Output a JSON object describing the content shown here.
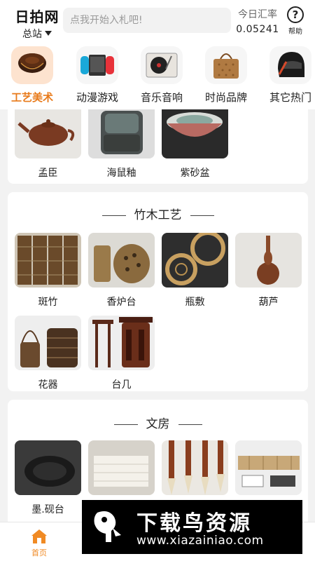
{
  "header": {
    "brand_title": "日拍网",
    "brand_sub": "总站",
    "search_placeholder": "点我开始入札吧!",
    "rate_label": "今日汇率",
    "rate_value": "0.05241",
    "help_label": "帮助",
    "help_symbol": "?"
  },
  "categories": [
    {
      "label": "工艺美术",
      "icon": "lacquer-box-icon",
      "active": true
    },
    {
      "label": "动漫游戏",
      "icon": "game-controller-icon",
      "active": false
    },
    {
      "label": "音乐音响",
      "icon": "turntable-icon",
      "active": false
    },
    {
      "label": "时尚品牌",
      "icon": "handbag-icon",
      "active": false
    },
    {
      "label": "其它热门",
      "icon": "helmet-icon",
      "active": false
    }
  ],
  "section_top": {
    "items": [
      {
        "label": "孟臣",
        "icon": "teapot-icon"
      },
      {
        "label": "海鼠釉",
        "icon": "glazed-pot-icon"
      },
      {
        "label": "紫砂盆",
        "icon": "bowl-icon"
      }
    ]
  },
  "section_bamboo": {
    "title": "竹木工艺",
    "items": [
      {
        "label": "斑竹",
        "icon": "screen-icon"
      },
      {
        "label": "香炉台",
        "icon": "incense-burner-icon"
      },
      {
        "label": "瓶敷",
        "icon": "woven-mat-icon"
      },
      {
        "label": "葫芦",
        "icon": "gourd-vase-icon"
      },
      {
        "label": "花器",
        "icon": "flower-basket-icon"
      },
      {
        "label": "台几",
        "icon": "stand-table-icon"
      }
    ]
  },
  "section_study": {
    "title": "文房",
    "items": [
      {
        "label": "墨.砚台",
        "icon": "inkstone-icon"
      },
      {
        "label": "",
        "icon": "paper-icon"
      },
      {
        "label": "",
        "icon": "brushes-icon"
      },
      {
        "label": "",
        "icon": "book-box-icon"
      }
    ]
  },
  "tabbar": {
    "home_label": "首页"
  },
  "watermark": {
    "title": "下载鸟资源",
    "url": "www.xiazainiao.com"
  },
  "colors": {
    "accent": "#e87a1a",
    "tab_active": "#f08a24"
  }
}
